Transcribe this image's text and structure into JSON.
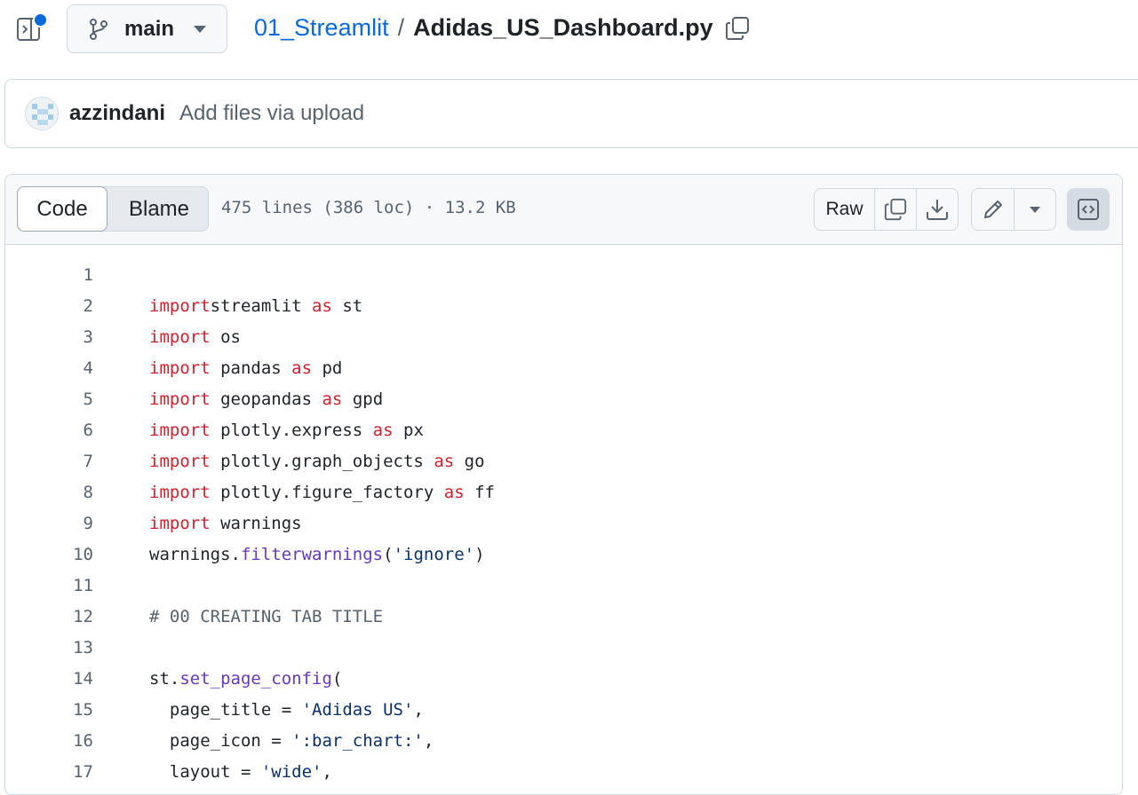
{
  "header": {
    "branch_label": "main",
    "repo_crumb": "01_Streamlit",
    "separator": "/",
    "file_name": "Adidas_US_Dashboard.py"
  },
  "commit": {
    "author": "azzindani",
    "message": "Add files via upload"
  },
  "file": {
    "tabs": [
      "Code",
      "Blame"
    ],
    "meta": "475 lines (386 loc) · 13.2 KB",
    "raw_label": "Raw"
  },
  "code_lines": [
    {
      "n": "1",
      "tokens": []
    },
    {
      "n": "2",
      "tokens": [
        [
          "kw",
          "import"
        ],
        [
          "",
          "streamlit "
        ],
        [
          "kw",
          "as"
        ],
        [
          "",
          " st"
        ]
      ]
    },
    {
      "n": "3",
      "tokens": [
        [
          "kw",
          "import"
        ],
        [
          "",
          " os"
        ]
      ]
    },
    {
      "n": "4",
      "tokens": [
        [
          "kw",
          "import"
        ],
        [
          "",
          " pandas "
        ],
        [
          "kw",
          "as"
        ],
        [
          "",
          " pd"
        ]
      ]
    },
    {
      "n": "5",
      "tokens": [
        [
          "kw",
          "import"
        ],
        [
          "",
          " geopandas "
        ],
        [
          "kw",
          "as"
        ],
        [
          "",
          " gpd"
        ]
      ]
    },
    {
      "n": "6",
      "tokens": [
        [
          "kw",
          "import"
        ],
        [
          "",
          " plotly.express "
        ],
        [
          "kw",
          "as"
        ],
        [
          "",
          " px"
        ]
      ]
    },
    {
      "n": "7",
      "tokens": [
        [
          "kw",
          "import"
        ],
        [
          "",
          " plotly.graph_objects "
        ],
        [
          "kw",
          "as"
        ],
        [
          "",
          " go"
        ]
      ]
    },
    {
      "n": "8",
      "tokens": [
        [
          "kw",
          "import"
        ],
        [
          "",
          " plotly.figure_factory "
        ],
        [
          "kw",
          "as"
        ],
        [
          "",
          " ff"
        ]
      ]
    },
    {
      "n": "9",
      "tokens": [
        [
          "kw",
          "import"
        ],
        [
          "",
          " warnings"
        ]
      ]
    },
    {
      "n": "10",
      "tokens": [
        [
          "",
          "warnings."
        ],
        [
          "fn",
          "filterwarnings"
        ],
        [
          "",
          "("
        ],
        [
          "str",
          "'ignore'"
        ],
        [
          "",
          ")"
        ]
      ]
    },
    {
      "n": "11",
      "tokens": []
    },
    {
      "n": "12",
      "tokens": [
        [
          "cm",
          "# 00 CREATING TAB TITLE"
        ]
      ]
    },
    {
      "n": "13",
      "tokens": []
    },
    {
      "n": "14",
      "tokens": [
        [
          "",
          "st."
        ],
        [
          "fn",
          "set_page_config"
        ],
        [
          "",
          "("
        ]
      ]
    },
    {
      "n": "15",
      "tokens": [
        [
          "",
          "  page_title = "
        ],
        [
          "str",
          "'Adidas US'"
        ],
        [
          "",
          ","
        ]
      ]
    },
    {
      "n": "16",
      "tokens": [
        [
          "",
          "  page_icon = "
        ],
        [
          "str",
          "':bar_chart:'"
        ],
        [
          "",
          ","
        ]
      ]
    },
    {
      "n": "17",
      "tokens": [
        [
          "",
          "  layout = "
        ],
        [
          "str",
          "'wide'"
        ],
        [
          "",
          ","
        ]
      ]
    }
  ]
}
